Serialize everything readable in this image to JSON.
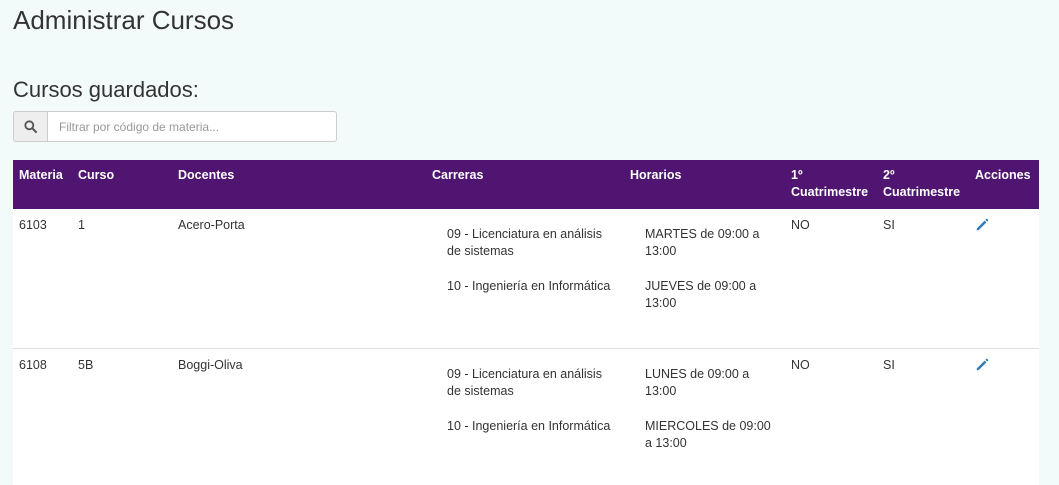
{
  "header": {
    "title": "Administrar Cursos",
    "section_title": "Cursos guardados:"
  },
  "filter": {
    "icon": "search-icon",
    "placeholder": "Filtrar por código de materia...",
    "value": ""
  },
  "table": {
    "columns": [
      "Materia",
      "Curso",
      "Docentes",
      "Carreras",
      "Horarios",
      "1º Cuatrimestre",
      "2º Cuatrimestre",
      "Acciones"
    ],
    "rows": [
      {
        "materia": "6103",
        "curso": "1",
        "docentes": "Acero-Porta",
        "carreras": [
          "09 - Licenciatura en análisis de sistemas",
          "10 - Ingeniería en Informática"
        ],
        "horarios": [
          "MARTES de 09:00 a 13:00",
          "JUEVES de 09:00 a 13:00"
        ],
        "cuatrimestre1": "NO",
        "cuatrimestre2": "SI",
        "action_icon": "pencil-icon"
      },
      {
        "materia": "6108",
        "curso": "5B",
        "docentes": "Boggi-Oliva",
        "carreras": [
          "09 - Licenciatura en análisis de sistemas",
          "10 - Ingeniería en Informática"
        ],
        "horarios": [
          "LUNES de 09:00 a 13:00",
          "MIERCOLES de 09:00 a 13:00"
        ],
        "cuatrimestre1": "NO",
        "cuatrimestre2": "SI",
        "action_icon": "pencil-icon"
      }
    ]
  },
  "colors": {
    "header_bg": "#4f1570",
    "page_bg": "#f3fbfa",
    "edit_icon": "#337ab7"
  }
}
